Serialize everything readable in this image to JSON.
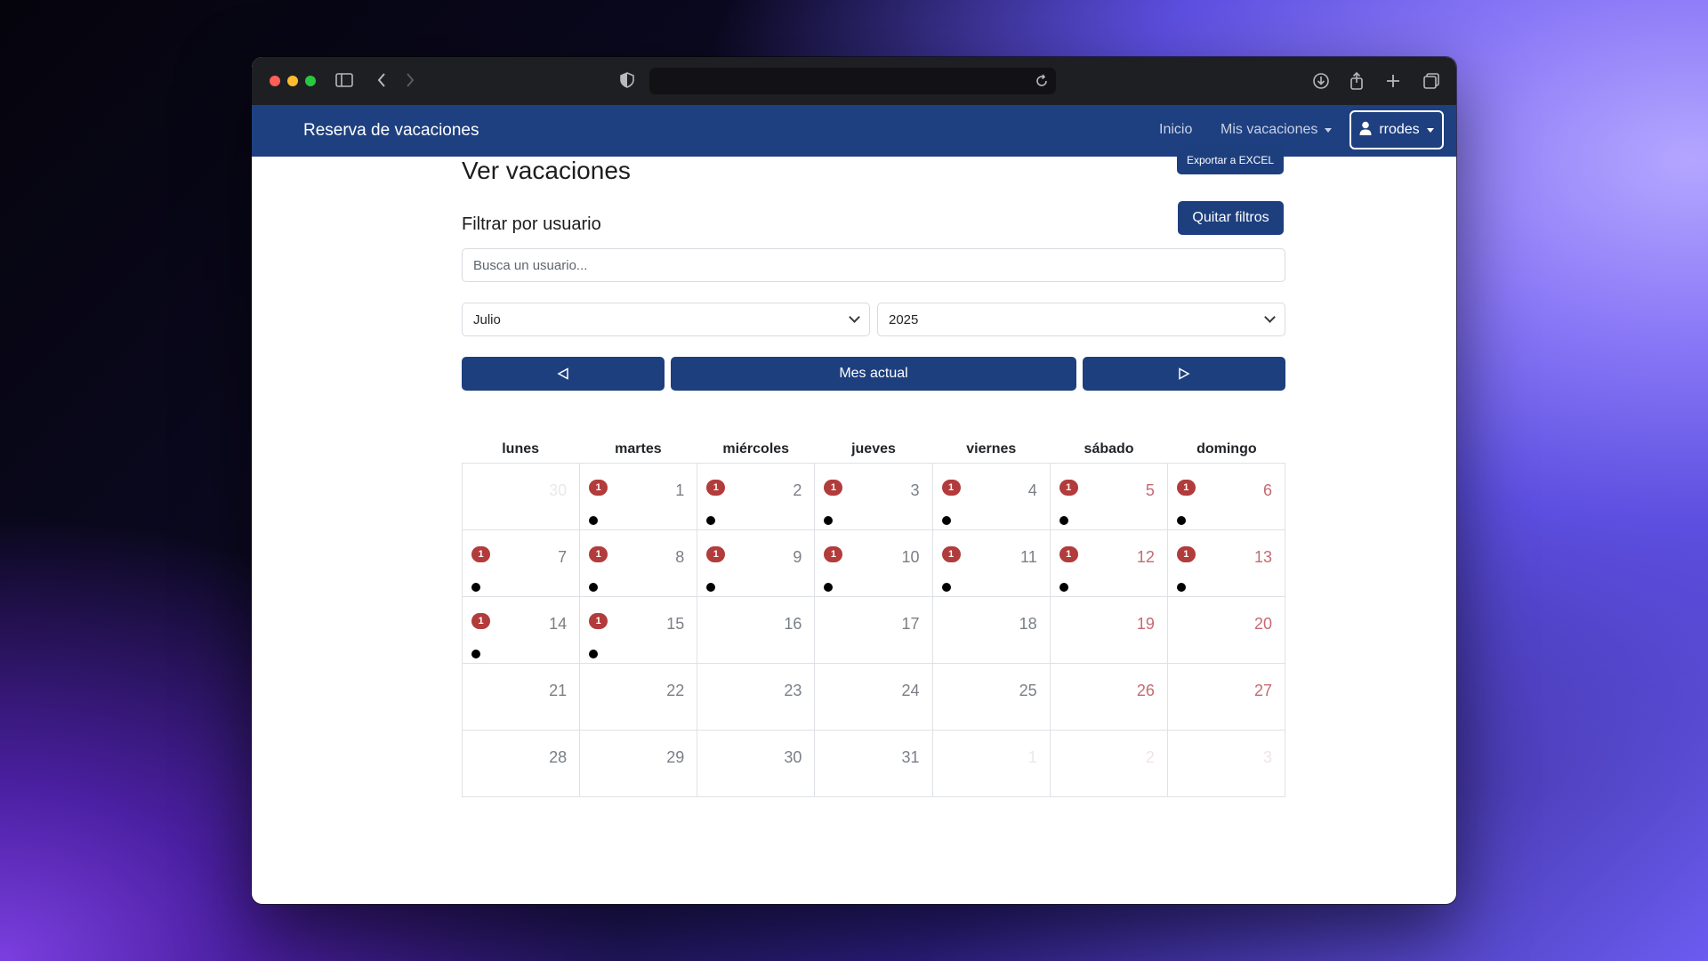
{
  "app": {
    "brand": "Reserva de vacaciones"
  },
  "nav": {
    "home": "Inicio",
    "my_vacations": "Mis vacaciones",
    "user": "rrodes"
  },
  "page": {
    "title": "Ver vacaciones",
    "export_button": "Exportar a EXCEL",
    "filter_title": "Filtrar por usuario",
    "clear_filters_button": "Quitar filtros",
    "search_placeholder": "Busca un usuario...",
    "month_select": "Julio",
    "year_select": "2025",
    "current_month_button": "Mes actual"
  },
  "calendar": {
    "weekdays": [
      "lunes",
      "martes",
      "miércoles",
      "jueves",
      "viernes",
      "sábado",
      "domingo"
    ],
    "days": [
      {
        "day": "30",
        "other": true,
        "count": null
      },
      {
        "day": "1",
        "count": "1"
      },
      {
        "day": "2",
        "count": "1"
      },
      {
        "day": "3",
        "count": "1"
      },
      {
        "day": "4",
        "count": "1"
      },
      {
        "day": "5",
        "count": "1"
      },
      {
        "day": "6",
        "count": "1"
      },
      {
        "day": "7",
        "count": "1"
      },
      {
        "day": "8",
        "count": "1"
      },
      {
        "day": "9",
        "count": "1"
      },
      {
        "day": "10",
        "count": "1"
      },
      {
        "day": "11",
        "count": "1"
      },
      {
        "day": "12",
        "count": "1"
      },
      {
        "day": "13",
        "count": "1"
      },
      {
        "day": "14",
        "count": "1"
      },
      {
        "day": "15",
        "count": "1"
      },
      {
        "day": "16",
        "count": null
      },
      {
        "day": "17",
        "count": null
      },
      {
        "day": "18",
        "count": null
      },
      {
        "day": "19",
        "count": null
      },
      {
        "day": "20",
        "count": null
      },
      {
        "day": "21",
        "count": null
      },
      {
        "day": "22",
        "count": null
      },
      {
        "day": "23",
        "count": null
      },
      {
        "day": "24",
        "count": null
      },
      {
        "day": "25",
        "count": null
      },
      {
        "day": "26",
        "count": null
      },
      {
        "day": "27",
        "count": null
      },
      {
        "day": "28",
        "count": null
      },
      {
        "day": "29",
        "count": null
      },
      {
        "day": "30",
        "count": null
      },
      {
        "day": "31",
        "count": null
      },
      {
        "day": "1",
        "other": true,
        "count": null
      },
      {
        "day": "2",
        "other": true,
        "count": null
      },
      {
        "day": "3",
        "other": true,
        "count": null
      }
    ]
  },
  "colors": {
    "navbar": "#1e4080",
    "button": "#1e3f7e",
    "badge": "#b23b3b",
    "weekend": "#c46a72"
  },
  "icons": {
    "prev": "triangle-left-icon",
    "next": "triangle-right-icon",
    "user": "person-icon"
  }
}
